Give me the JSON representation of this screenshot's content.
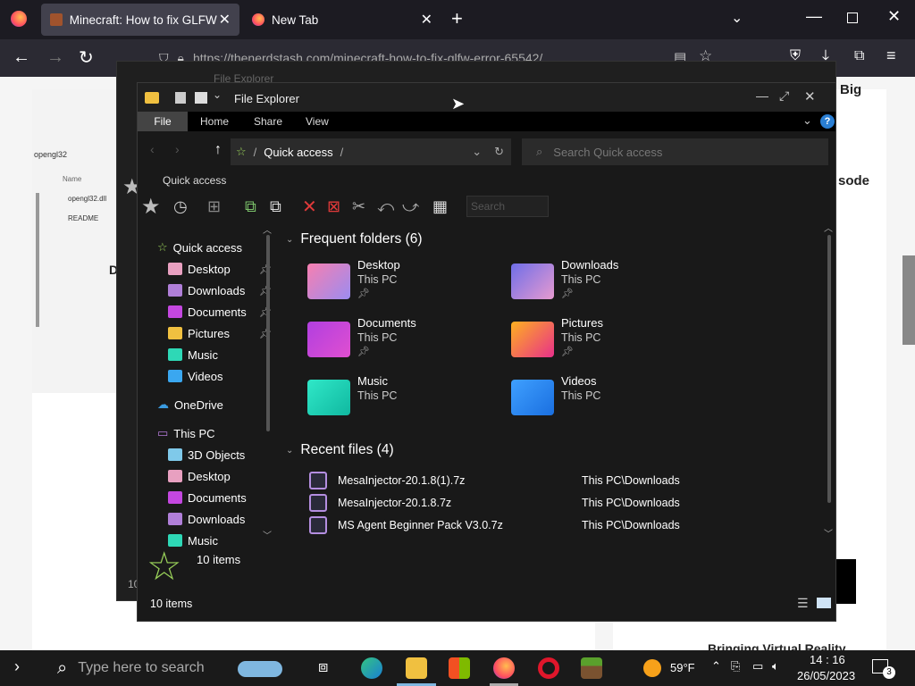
{
  "browser": {
    "tabs": [
      {
        "title": "Minecraft: How to fix GLFW e",
        "active": true
      },
      {
        "title": "New Tab",
        "active": false
      }
    ],
    "url": "https://thenerdstash.com/minecraft-how-to-fix-glfw-error-65542/",
    "new_tab_symbol": "+"
  },
  "page_behind": {
    "folder_label": "opengl32",
    "column_name": "Name",
    "files": [
      "opengl32.dll",
      "README"
    ],
    "right_snippets": [
      "Big",
      "sode"
    ],
    "letter_d": "D",
    "bottom_right": "Bringing Virtual Reality"
  },
  "back_window": {
    "title": "File Explorer",
    "items": "10 items"
  },
  "explorer": {
    "title": "File Explorer",
    "ribbon_tabs": [
      "File",
      "Home",
      "Share",
      "View"
    ],
    "address": "Quick access",
    "search_placeholder": "Search Quick access",
    "toolbar_label": "Quick access",
    "toolbar_search": "Search",
    "nav": {
      "quick_access": "Quick access",
      "pinned": [
        {
          "label": "Desktop",
          "pinned": true,
          "color": "#e8a0c0"
        },
        {
          "label": "Downloads",
          "pinned": true,
          "color": "#b07fd8"
        },
        {
          "label": "Documents",
          "pinned": true,
          "color": "#c447e0"
        },
        {
          "label": "Pictures",
          "pinned": true,
          "color": "#f0c040"
        },
        {
          "label": "Music",
          "pinned": false,
          "color": "#2ed8b6"
        },
        {
          "label": "Videos",
          "pinned": false,
          "color": "#3aa7f0"
        }
      ],
      "onedrive": "OneDrive",
      "this_pc": "This PC",
      "pc_items": [
        {
          "label": "3D Objects",
          "color": "#7fc9ea"
        },
        {
          "label": "Desktop",
          "color": "#e8a0c0"
        },
        {
          "label": "Documents",
          "color": "#c447e0"
        },
        {
          "label": "Downloads",
          "color": "#b07fd8"
        },
        {
          "label": "Music",
          "color": "#2ed8b6"
        }
      ]
    },
    "frequent_header": "Frequent folders (6)",
    "frequent": [
      {
        "name": "Desktop",
        "loc": "This PC",
        "pinned": true,
        "color1": "#f77fb0",
        "color2": "#9b8cf0"
      },
      {
        "name": "Downloads",
        "loc": "This PC",
        "pinned": true,
        "color1": "#6f6ee8",
        "color2": "#e79ad0"
      },
      {
        "name": "Documents",
        "loc": "This PC",
        "pinned": true,
        "color1": "#b13fe0",
        "color2": "#e04fd0"
      },
      {
        "name": "Pictures",
        "loc": "This PC",
        "pinned": true,
        "color1": "#ffb020",
        "color2": "#e8308a"
      },
      {
        "name": "Music",
        "loc": "This PC",
        "pinned": false,
        "color1": "#30e8c8",
        "color2": "#10b8a0"
      },
      {
        "name": "Videos",
        "loc": "This PC",
        "pinned": false,
        "color1": "#3fa0ff",
        "color2": "#1a6fe0"
      }
    ],
    "recent_header": "Recent files (4)",
    "recent": [
      {
        "name": "MesaInjector-20.1.8(1).7z",
        "path": "This PC\\Downloads"
      },
      {
        "name": "MesaInjector-20.1.8.7z",
        "path": "This PC\\Downloads"
      },
      {
        "name": "MS Agent Beginner Pack V3.0.7z",
        "path": "This PC\\Downloads"
      }
    ],
    "status_items": "10 items",
    "status_items_big": "10 items"
  },
  "taskbar": {
    "search_placeholder": "Type here to search",
    "weather": "59°F",
    "time": "14 : 16",
    "date": "26/05/2023",
    "notification_count": "3"
  }
}
